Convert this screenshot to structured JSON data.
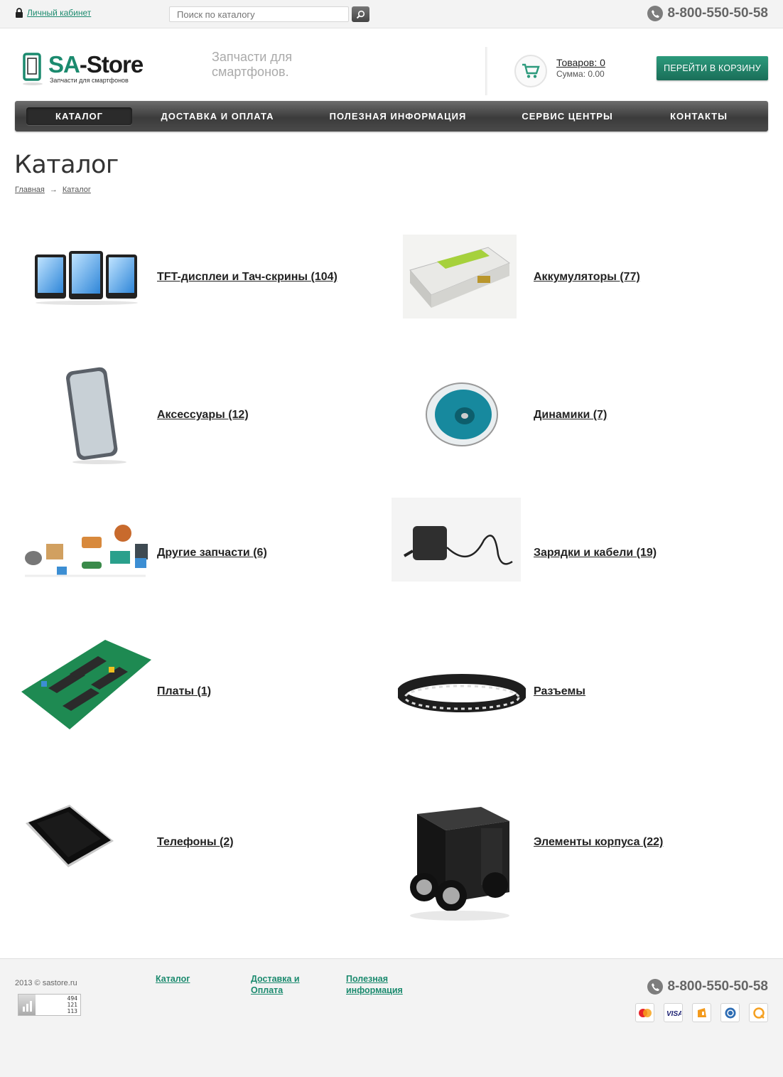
{
  "topbar": {
    "account_label": "Личный кабинет",
    "search_placeholder": "Поиск по каталогу",
    "phone": "8-800-550-50-58"
  },
  "header": {
    "logo_prefix": "SA",
    "logo_suffix": "-Store",
    "logo_subtitle": "Запчасти для смартфонов",
    "tagline": "Запчасти для смартфонов.",
    "cart_items": "Товаров: 0",
    "cart_sum": "Сумма: 0.00",
    "cart_button": "ПЕРЕЙТИ В КОРЗИНУ"
  },
  "nav": {
    "items": [
      {
        "label": "КАТАЛОГ",
        "active": true
      },
      {
        "label": "ДОСТАВКА И ОПЛАТА"
      },
      {
        "label": "ПОЛЕЗНАЯ ИНФОРМАЦИЯ"
      },
      {
        "label": "СЕРВИС ЦЕНТРЫ"
      },
      {
        "label": "КОНТАКТЫ"
      }
    ]
  },
  "page": {
    "title": "Каталог",
    "breadcrumb": {
      "home": "Главная",
      "arrow": "→",
      "current": "Каталог"
    }
  },
  "catalog": {
    "items": [
      {
        "label": "TFT-дисплеи и Тач-скрины (104)",
        "icon": "tablets-image"
      },
      {
        "label": "Аккумуляторы (77)",
        "icon": "battery-image"
      },
      {
        "label": "Аксессуары (12)",
        "icon": "phone-case-image"
      },
      {
        "label": "Динамики (7)",
        "icon": "speaker-image"
      },
      {
        "label": "Другие запчасти (6)",
        "icon": "components-image"
      },
      {
        "label": "Зарядки и кабели (19)",
        "icon": "charger-image"
      },
      {
        "label": "Платы (1)",
        "icon": "circuit-board-image"
      },
      {
        "label": "Разъемы",
        "icon": "smd-tape-image"
      },
      {
        "label": "Телефоны (2)",
        "icon": "smartphone-image"
      },
      {
        "label": "Элементы корпуса (22)",
        "icon": "pc-case-image"
      }
    ]
  },
  "footer": {
    "copyright": "2013 © sastore.ru",
    "counter": [
      "494",
      "121",
      "113"
    ],
    "links": [
      {
        "line1": "Каталог",
        "line2": ""
      },
      {
        "line1": "Доставка и",
        "line2": "Оплата"
      },
      {
        "line1": "Полезная",
        "line2": "информация"
      }
    ],
    "phone": "8-800-550-50-58",
    "payments": [
      "mastercard-icon",
      "visa-icon",
      "yandex-money-icon",
      "webmoney-icon",
      "qiwi-icon"
    ]
  },
  "colors": {
    "accent": "#1b8a6e",
    "nav_bg": "#4a4a4a",
    "text": "#333333"
  }
}
